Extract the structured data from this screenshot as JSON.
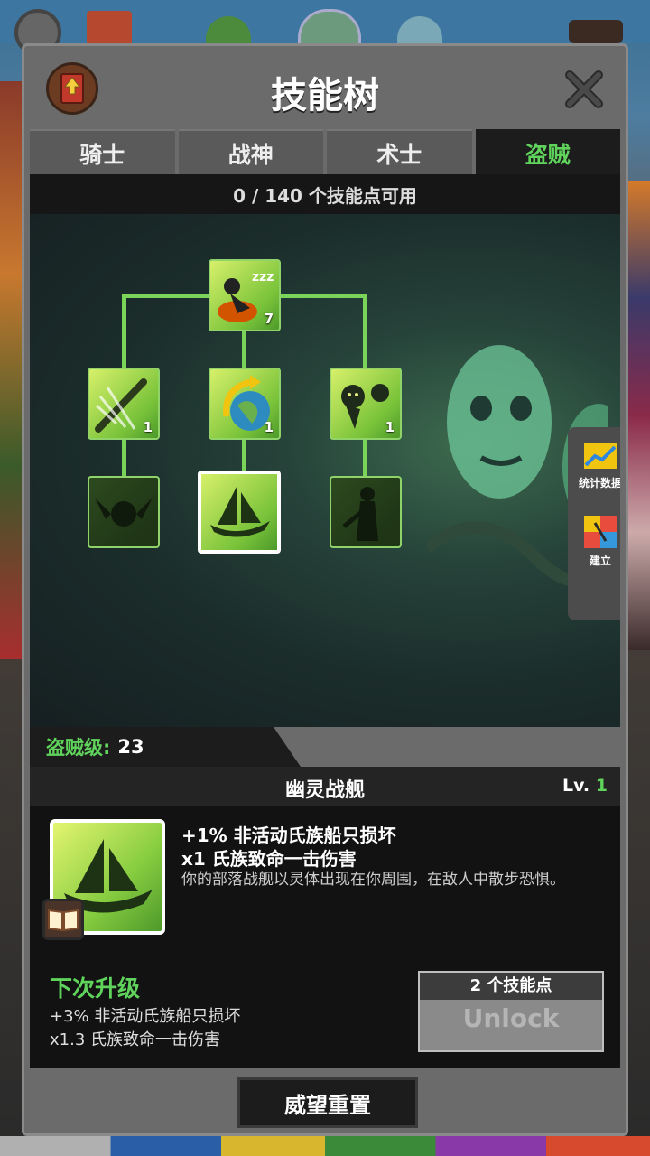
{
  "header": {
    "title": "技能树"
  },
  "tabs": [
    {
      "label": "骑士",
      "active": false
    },
    {
      "label": "战神",
      "active": false
    },
    {
      "label": "术士",
      "active": false
    },
    {
      "label": "盗贼",
      "active": true
    }
  ],
  "points_available": "0 / 140 个技能点可用",
  "tree": {
    "nodes": [
      {
        "id": "sleeping-gold",
        "level": "7",
        "state": "unlocked"
      },
      {
        "id": "sword-slash",
        "level": "1",
        "state": "unlocked"
      },
      {
        "id": "globe-arrow",
        "level": "1",
        "state": "unlocked"
      },
      {
        "id": "shadow-demons",
        "level": "1",
        "state": "unlocked"
      },
      {
        "id": "winged-creature",
        "level": "",
        "state": "locked"
      },
      {
        "id": "ghost-ship",
        "level": "",
        "state": "selected"
      },
      {
        "id": "shadow-warrior",
        "level": "",
        "state": "locked"
      }
    ]
  },
  "side_tabs": [
    {
      "label": "统计数据",
      "icon": "chart-icon"
    },
    {
      "label": "建立",
      "icon": "build-icon"
    }
  ],
  "rank": {
    "label": "盗贼级:",
    "value": "23"
  },
  "detail": {
    "name": "幽灵战舰",
    "level_label": "Lv.",
    "level_value": "1",
    "effects": [
      "+1% 非活动氏族船只损坏",
      "x1 氏族致命一击伤害"
    ],
    "description": "你的部落战舰以灵体出现在你周围，在敌人中散步恐惧。",
    "next_title": "下次升级",
    "next_effects": [
      "+3% 非活动氏族船只损坏",
      "x1.3 氏族致命一击伤害"
    ],
    "unlock_cost": "2 个技能点",
    "unlock_label": "Unlock"
  },
  "reset_label": "威望重置",
  "colors": {
    "accent_green": "#5fd35b",
    "node_border": "#8fd36a",
    "panel": "#6b6b6b"
  }
}
